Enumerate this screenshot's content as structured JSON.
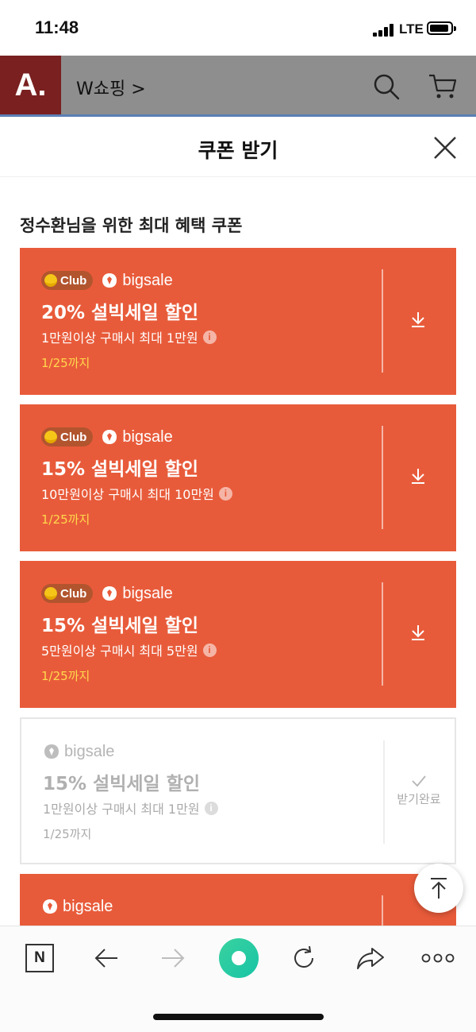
{
  "status_bar": {
    "time": "11:48",
    "network": "LTE"
  },
  "app_bar": {
    "logo": "A.",
    "breadcrumb": "W쇼핑 >"
  },
  "sheet": {
    "title": "쿠폰 받기",
    "subtitle": "정수환님을 위한 최대 혜택 쿠폰"
  },
  "coupons": [
    {
      "club": "Club",
      "brand": "bigsale",
      "title": "20% 설빅세일 할인",
      "condition": "1만원이상 구매시 최대 1만원",
      "until": "1/25까지",
      "state": "download"
    },
    {
      "club": "Club",
      "brand": "bigsale",
      "title": "15% 설빅세일 할인",
      "condition": "10만원이상 구매시 최대 10만원",
      "until": "1/25까지",
      "state": "download"
    },
    {
      "club": "Club",
      "brand": "bigsale",
      "title": "15% 설빅세일 할인",
      "condition": "5만원이상 구매시 최대 5만원",
      "until": "1/25까지",
      "state": "download"
    },
    {
      "brand": "bigsale",
      "title": "15% 설빅세일 할인",
      "condition": "1만원이상 구매시 최대 1만원",
      "until": "1/25까지",
      "state": "received",
      "received_label": "받기완료"
    },
    {
      "brand": "bigsale"
    }
  ],
  "toolbar": {
    "n_label": "N"
  },
  "colors": {
    "coupon_bg": "#e85b3a",
    "until_text": "#ffd84d",
    "appbar_overlay": "#8e8e8e",
    "logo_bg": "#7a2020",
    "browser_green": "#2fcf9f"
  }
}
